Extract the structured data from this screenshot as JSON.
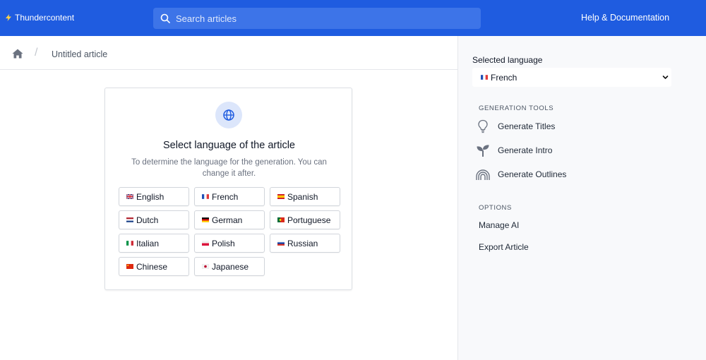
{
  "topbar": {
    "brand": "Thundercontent",
    "search_placeholder": "Search articles",
    "help_label": "Help & Documentation"
  },
  "breadcrumb": {
    "current": "Untitled article"
  },
  "card": {
    "title": "Select language of the article",
    "description": "To determine the language for the generation. You can change it after.",
    "languages": [
      {
        "label": "English",
        "flag": "uk-flag-icon"
      },
      {
        "label": "French",
        "flag": "france-flag-icon"
      },
      {
        "label": "Spanish",
        "flag": "spain-flag-icon"
      },
      {
        "label": "Dutch",
        "flag": "netherlands-flag-icon"
      },
      {
        "label": "German",
        "flag": "germany-flag-icon"
      },
      {
        "label": "Portuguese",
        "flag": "portugal-flag-icon"
      },
      {
        "label": "Italian",
        "flag": "italy-flag-icon"
      },
      {
        "label": "Polish",
        "flag": "poland-flag-icon"
      },
      {
        "label": "Russian",
        "flag": "russia-flag-icon"
      },
      {
        "label": "Chinese",
        "flag": "china-flag-icon"
      },
      {
        "label": "Japanese",
        "flag": "japan-flag-icon"
      }
    ]
  },
  "sidebar": {
    "selected_language_label": "Selected language",
    "selected_language_value": "French",
    "generation_tools_heading": "GENERATION TOOLS",
    "tools": [
      {
        "label": "Generate Titles",
        "icon": "lightbulb-icon"
      },
      {
        "label": "Generate Intro",
        "icon": "sprout-icon"
      },
      {
        "label": "Generate Outlines",
        "icon": "rainbow-icon"
      }
    ],
    "options_heading": "OPTIONS",
    "options": [
      {
        "label": "Manage AI"
      },
      {
        "label": "Export Article"
      }
    ]
  },
  "colors": {
    "brand_blue": "#1f5ce0",
    "search_bg": "#3d74e8",
    "sidebar_bg": "#f8f9fb",
    "globe_bg": "#dce6fb"
  }
}
